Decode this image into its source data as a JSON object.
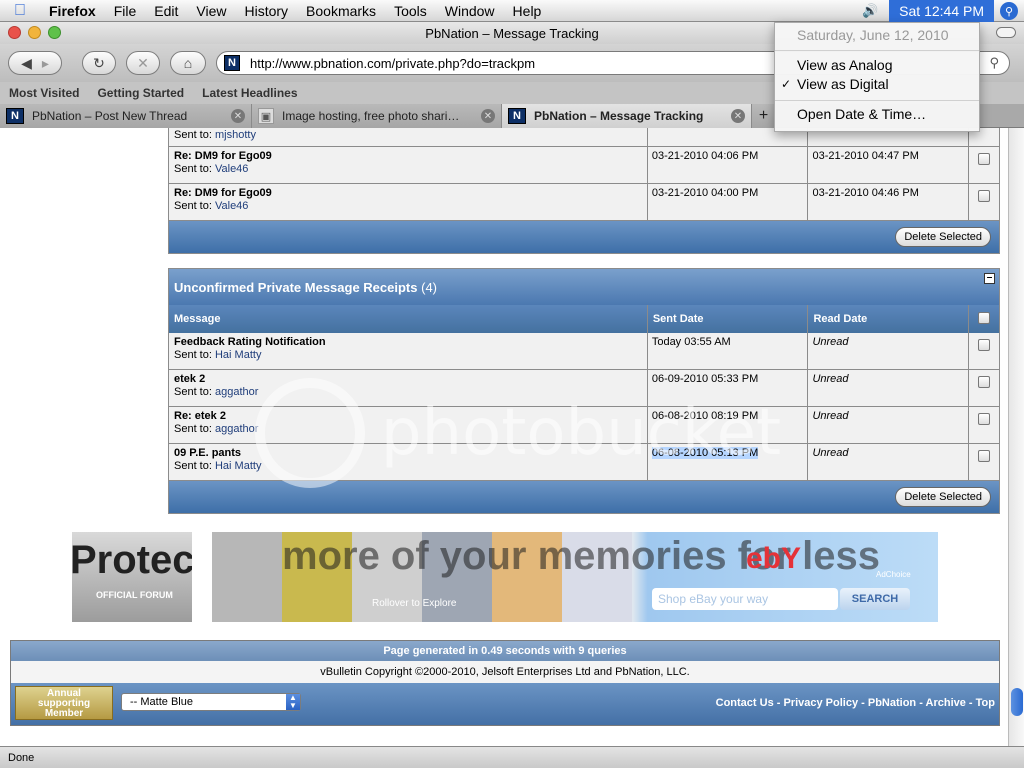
{
  "menubar": {
    "app": "Firefox",
    "items": [
      "File",
      "Edit",
      "View",
      "History",
      "Bookmarks",
      "Tools",
      "Window",
      "Help"
    ],
    "clock": "Sat 12:44 PM"
  },
  "clock_menu": {
    "date": "Saturday, June 12, 2010",
    "items": [
      "View as Analog",
      "View as Digital",
      "Open Date & Time…"
    ],
    "checked": "View as Digital"
  },
  "window": {
    "title": "PbNation – Message Tracking"
  },
  "toolbar": {
    "url": "http://www.pbnation.com/private.php?do=trackpm"
  },
  "bookmarks": [
    "Most Visited",
    "Getting Started",
    "Latest Headlines"
  ],
  "tabs": [
    {
      "label": "PbNation – Post New Thread",
      "icon": "N"
    },
    {
      "label": "Image hosting, free photo shari…",
      "icon": "photo"
    },
    {
      "label": "PbNation – Message Tracking",
      "icon": "N"
    }
  ],
  "confirmed": {
    "partial_sent_to": "mjshotty",
    "rows": [
      {
        "subject": "Re: DM9 for Ego09",
        "sent_to_label": "Sent to:",
        "recipient": "Vale46",
        "sent": "03-21-2010 04:06 PM",
        "read": "03-21-2010 04:47 PM"
      },
      {
        "subject": "Re: DM9 for Ego09",
        "sent_to_label": "Sent to:",
        "recipient": "Vale46",
        "sent": "03-21-2010 04:00 PM",
        "read": "03-21-2010 04:46 PM"
      }
    ],
    "delete_label": "Delete Selected"
  },
  "unconfirmed": {
    "title": "Unconfirmed Private Message Receipts",
    "count": "(4)",
    "headers": [
      "Message",
      "Sent Date",
      "Read Date"
    ],
    "rows": [
      {
        "subject": "Feedback Rating Notification",
        "sent_to_label": "Sent to:",
        "recipient": "Hai Matty",
        "sent": "Today 03:55 AM",
        "read": "Unread"
      },
      {
        "subject": "etek 2",
        "sent_to_label": "Sent to:",
        "recipient": "aggathor",
        "sent": "06-09-2010 05:33 PM",
        "read": "Unread"
      },
      {
        "subject": "Re: etek 2",
        "sent_to_label": "Sent to:",
        "recipient": "aggathor",
        "sent": "06-08-2010 08:19 PM",
        "read": "Unread"
      },
      {
        "subject": "09 P.E. pants",
        "sent_to_label": "Sent to:",
        "recipient": "Hai Matty",
        "sent": "06-08-2010 05:13 PM",
        "read": "Unread"
      }
    ],
    "delete_label": "Delete Selected"
  },
  "banners": {
    "protect": "Protect",
    "official": "OFFICIAL FORUM",
    "memories": "more of your memories for less",
    "rollover": "Rollover to Explore",
    "ebay_placeholder": "Shop eBay your way",
    "search": "SEARCH",
    "adchoice": "AdChoice"
  },
  "footer": {
    "generated": "Page generated in 0.49 seconds with 9 queries",
    "copyright": "vBulletin Copyright ©2000-2010, Jelsoft Enterprises Ltd and PbNation, LLC.",
    "badge_line1": "Annual",
    "badge_line2": "supporting",
    "badge_line3": "Member",
    "style_select": "-- Matte Blue",
    "links": [
      "Contact Us",
      "Privacy Policy",
      "PbNation",
      "Archive",
      "Top"
    ]
  },
  "status": "Done",
  "watermark": "photobucket",
  "colors": {
    "accent": "#2f6ed8",
    "forum_blue": "#4b78b0"
  }
}
